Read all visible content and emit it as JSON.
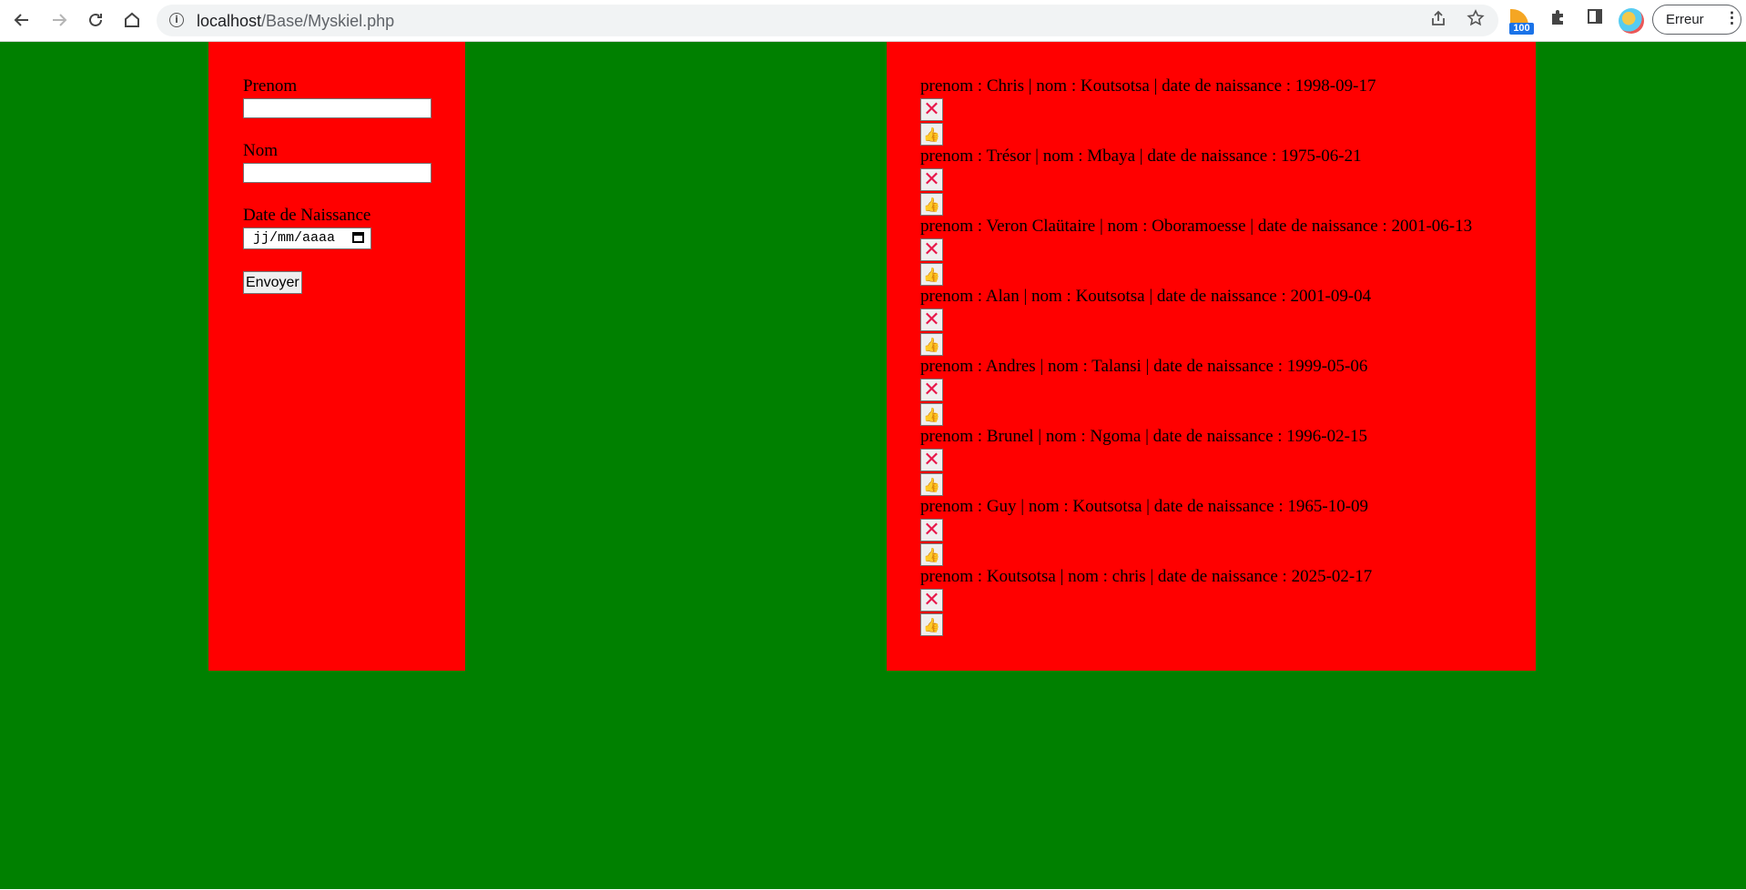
{
  "browser": {
    "url_host": "localhost",
    "url_path": "/Base/Myskiel.php",
    "extension_badge": "100",
    "profile_label": "Erreur",
    "icons": {
      "back": "arrow-left-icon",
      "forward": "arrow-right-icon",
      "reload": "reload-icon",
      "home": "home-icon",
      "site_info": "info-icon",
      "share": "share-icon",
      "bookmark": "star-icon",
      "extensions": "puzzle-icon",
      "side_panel": "side-panel-icon",
      "menu": "kebab-menu-icon"
    }
  },
  "colors": {
    "page_background": "#008000",
    "panel_background": "#ff0000",
    "delete_icon": "#e8174b",
    "like_icon": "#f0a800"
  },
  "form": {
    "prenom_label": "Prenom",
    "prenom_value": "",
    "nom_label": "Nom",
    "nom_value": "",
    "date_label": "Date de Naissance",
    "date_placeholder": "jj/mm/aaaa",
    "submit_label": "Envoyer"
  },
  "entries": [
    "prenom : Chris | nom : Koutsotsa | date de naissance : 1998-09-17",
    "prenom : Trésor | nom : Mbaya | date de naissance : 1975-06-21",
    "prenom : Veron Claütaire | nom : Oboramoesse | date de naissance : 2001-06-13",
    "prenom : Alan | nom : Koutsotsa | date de naissance : 2001-09-04",
    "prenom : Andres | nom : Talansi | date de naissance : 1999-05-06",
    "prenom : Brunel | nom : Ngoma | date de naissance : 1996-02-15",
    "prenom : Guy | nom : Koutsotsa | date de naissance : 1965-10-09",
    "prenom : Koutsotsa | nom : chris | date de naissance : 2025-02-17"
  ],
  "entry_actions": {
    "delete_icon": "close-x-icon",
    "delete_glyph": "✕",
    "like_icon": "thumbs-up-icon",
    "like_glyph": "👍"
  }
}
